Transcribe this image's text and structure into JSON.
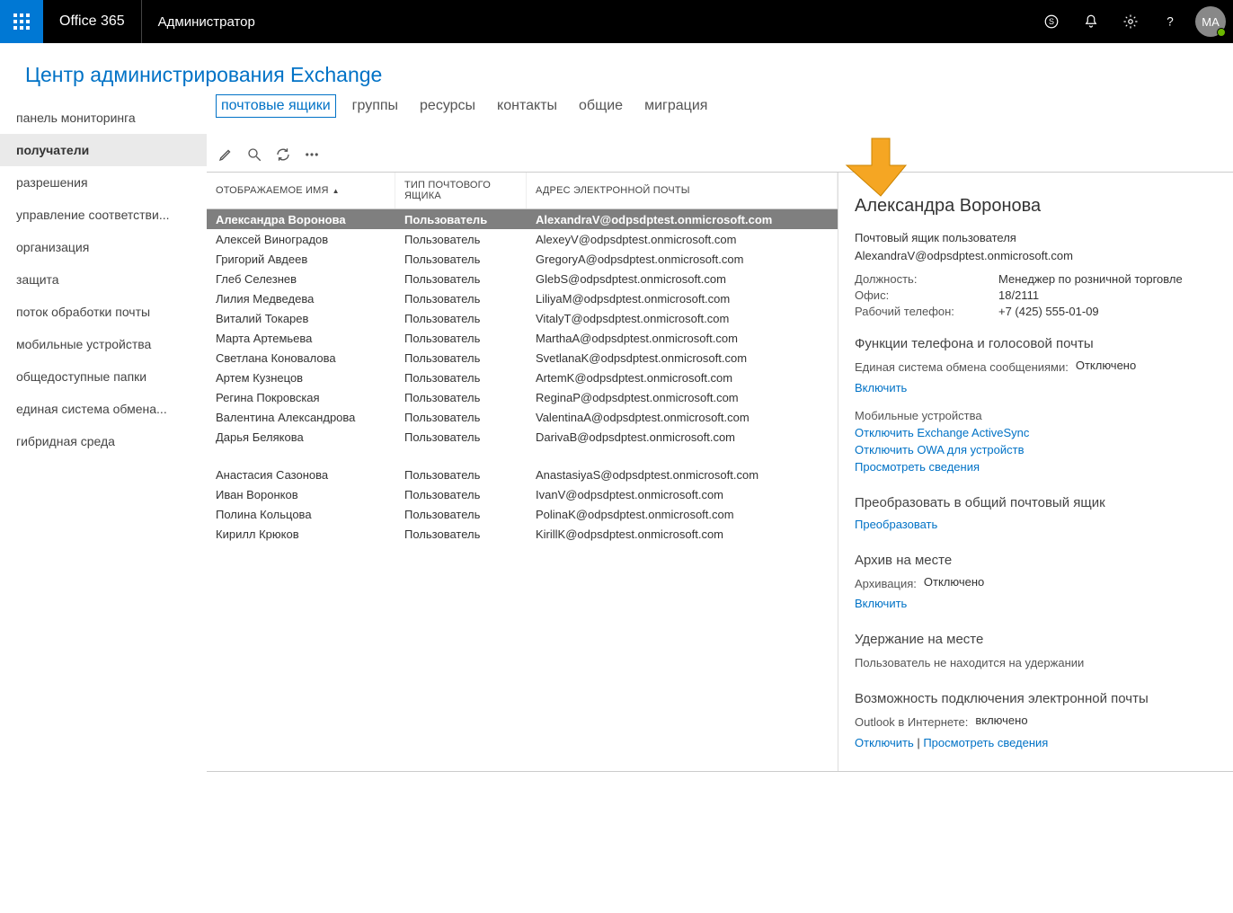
{
  "topbar": {
    "brand": "Office 365",
    "role": "Администратор",
    "avatar_initials": "MA"
  },
  "page_title": "Центр администрирования Exchange",
  "sidebar": {
    "items": [
      "панель мониторинга",
      "получатели",
      "разрешения",
      "управление соответстви...",
      "организация",
      "защита",
      "поток обработки почты",
      "мобильные устройства",
      "общедоступные папки",
      "единая система обмена...",
      "гибридная среда"
    ],
    "active_index": 1
  },
  "tabs": {
    "items": [
      "почтовые ящики",
      "группы",
      "ресурсы",
      "контакты",
      "общие",
      "миграция"
    ],
    "active_index": 0
  },
  "table": {
    "headers": {
      "name": "ОТОБРАЖАЕМОЕ ИМЯ",
      "type": "ТИП ПОЧТОВОГО ЯЩИКА",
      "email": "АДРЕС ЭЛЕКТРОННОЙ ПОЧТЫ"
    },
    "rows": [
      {
        "name": "Александра Воронова",
        "type": "Пользователь",
        "email": "AlexandraV@odpsdptest.onmicrosoft.com",
        "selected": true
      },
      {
        "name": "Алексей Виноградов",
        "type": "Пользователь",
        "email": "AlexeyV@odpsdptest.onmicrosoft.com"
      },
      {
        "name": "Григорий Авдеев",
        "type": "Пользователь",
        "email": "GregoryA@odpsdptest.onmicrosoft.com"
      },
      {
        "name": "Глеб Селезнев",
        "type": "Пользователь",
        "email": "GlebS@odpsdptest.onmicrosoft.com"
      },
      {
        "name": "Лилия Медведева",
        "type": "Пользователь",
        "email": "LiliyaM@odpsdptest.onmicrosoft.com"
      },
      {
        "name": "Виталий Токарев",
        "type": "Пользователь",
        "email": "VitalyT@odpsdptest.onmicrosoft.com"
      },
      {
        "name": "Марта Артемьева",
        "type": "Пользователь",
        "email": "MarthaA@odpsdptest.onmicrosoft.com"
      },
      {
        "name": "Светлана Коновалова",
        "type": "Пользователь",
        "email": "SvetlanaK@odpsdptest.onmicrosoft.com"
      },
      {
        "name": "Артем Кузнецов",
        "type": "Пользователь",
        "email": "ArtemK@odpsdptest.onmicrosoft.com"
      },
      {
        "name": "Регина Покровская",
        "type": "Пользователь",
        "email": "ReginaP@odpsdptest.onmicrosoft.com"
      },
      {
        "name": "Валентина Александрова",
        "type": "Пользователь",
        "email": "ValentinaA@odpsdptest.onmicrosoft.com"
      },
      {
        "name": "Дарья Белякова",
        "type": "Пользователь",
        "email": "DarivaB@odpsdptest.onmicrosoft.com"
      },
      {
        "_sep": true
      },
      {
        "name": "Анастасия Сазонова",
        "type": "Пользователь",
        "email": "AnastasiyaS@odpsdptest.onmicrosoft.com"
      },
      {
        "name": "Иван Воронков",
        "type": "Пользователь",
        "email": "IvanV@odpsdptest.onmicrosoft.com"
      },
      {
        "name": "Полина Кольцова",
        "type": "Пользователь",
        "email": "PolinaK@odpsdptest.onmicrosoft.com"
      },
      {
        "name": "Кирилл Крюков",
        "type": "Пользователь",
        "email": "KirillK@odpsdptest.onmicrosoft.com"
      }
    ]
  },
  "details": {
    "name": "Александра Воронова",
    "subtitle": "Почтовый ящик пользователя",
    "email": "AlexandraV@odpsdptest.onmicrosoft.com",
    "fields": {
      "position_label": "Должность:",
      "position_value": "Менеджер по розничной торговле",
      "office_label": "Офис:",
      "office_value": "18/2111",
      "phone_label": "Рабочий телефон:",
      "phone_value": "+7 (425) 555-01-09"
    },
    "phone_section": {
      "title": "Функции телефона и голосовой почты",
      "um_label": "Единая система обмена сообщениями:",
      "um_value": "Отключено",
      "enable_link": "Включить",
      "mobile_title": "Мобильные устройства",
      "link_disable_eas": "Отключить Exchange ActiveSync",
      "link_disable_owa": "Отключить OWA для устройств",
      "link_view": "Просмотреть сведения"
    },
    "convert_section": {
      "title": "Преобразовать в общий почтовый ящик",
      "link": "Преобразовать"
    },
    "archive_section": {
      "title": "Архив на месте",
      "label": "Архивация:",
      "value": "Отключено",
      "link": "Включить"
    },
    "hold_section": {
      "title": "Удержание на месте",
      "text": "Пользователь не находится на удержании"
    },
    "connect_section": {
      "title": "Возможность подключения электронной почты",
      "owa_label": "Outlook в Интернете:",
      "owa_value": "включено",
      "link_disable": "Отключить",
      "sep": " | ",
      "link_view": "Просмотреть сведения"
    }
  }
}
